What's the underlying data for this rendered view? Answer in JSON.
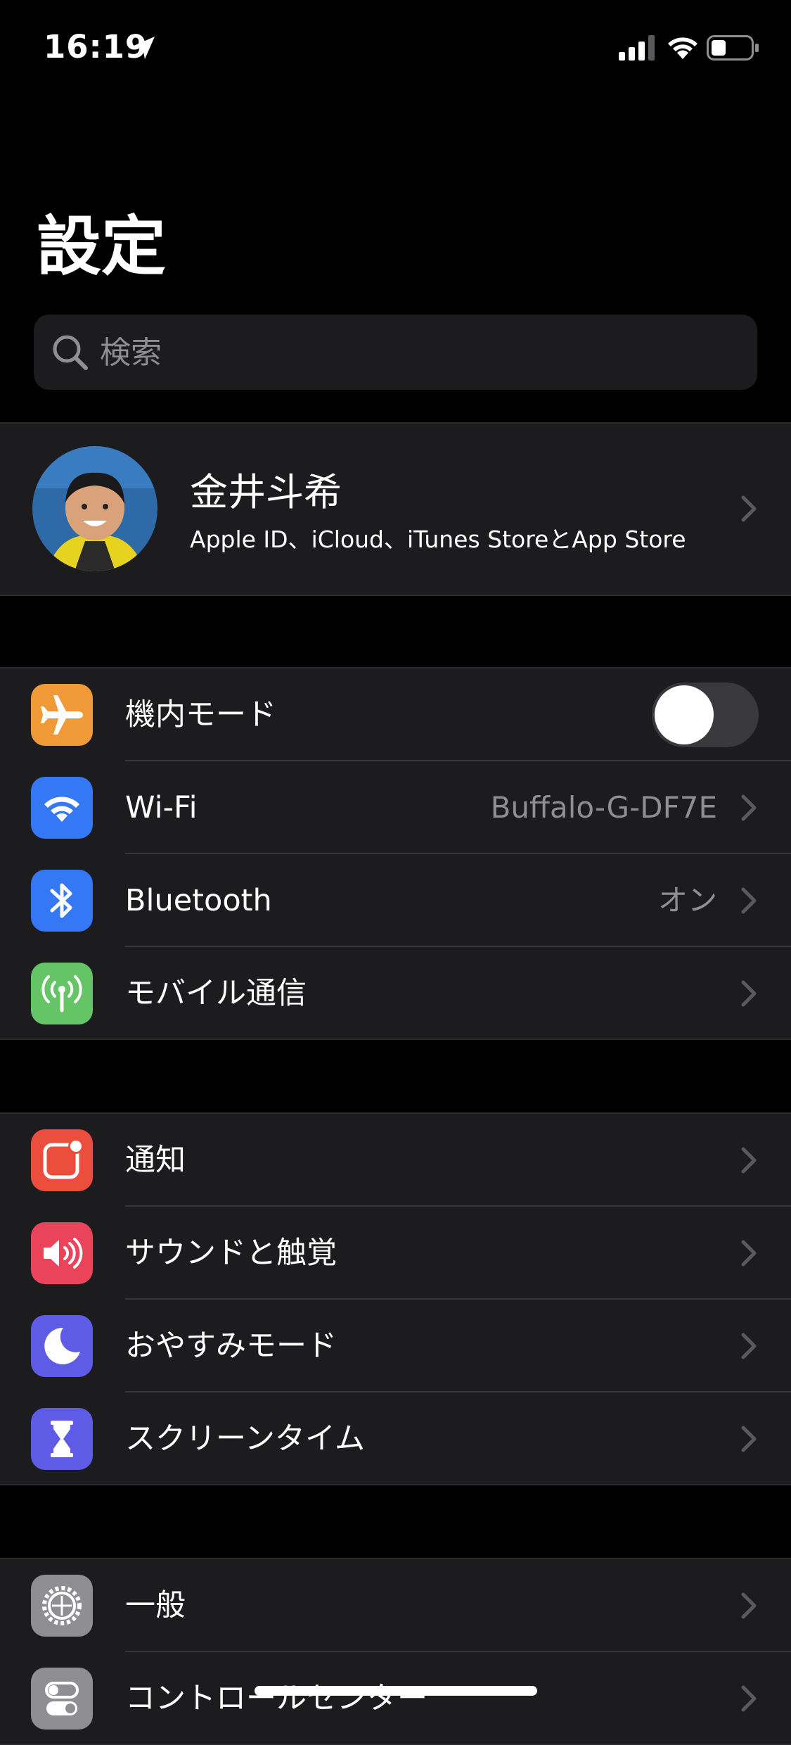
{
  "status_bar": {
    "time": "16:19",
    "icons": [
      "location-arrow-icon",
      "cellular-signal-icon",
      "wifi-icon",
      "battery-icon"
    ]
  },
  "header": {
    "title": "設定"
  },
  "search": {
    "placeholder": "検索",
    "value": ""
  },
  "profile": {
    "name": "金井斗希",
    "subtitle": "Apple ID、iCloud、iTunes StoreとApp Store"
  },
  "section1": {
    "rows": [
      {
        "label": "機内モード",
        "icon": "airplane-icon",
        "color": "#f09a37",
        "control": "toggle",
        "toggle_on": false
      },
      {
        "label": "Wi-Fi",
        "icon": "wifi-icon",
        "color": "#3478f6",
        "value": "Buffalo-G-DF7E"
      },
      {
        "label": "Bluetooth",
        "icon": "bluetooth-icon",
        "color": "#3478f6",
        "value": "オン"
      },
      {
        "label": "モバイル通信",
        "icon": "antenna-icon",
        "color": "#65c466"
      }
    ]
  },
  "section2": {
    "rows": [
      {
        "label": "通知",
        "icon": "notifications-icon",
        "color": "#eb4e3d"
      },
      {
        "label": "サウンドと触覚",
        "icon": "speaker-icon",
        "color": "#eb445a"
      },
      {
        "label": "おやすみモード",
        "icon": "moon-icon",
        "color": "#5e5ce6"
      },
      {
        "label": "スクリーンタイム",
        "icon": "hourglass-icon",
        "color": "#5e5ce6"
      }
    ]
  },
  "section3": {
    "rows": [
      {
        "label": "一般",
        "icon": "gear-icon",
        "color": "#8e8e93"
      },
      {
        "label": "コントロールセンター",
        "icon": "control-center-icon",
        "color": "#8e8e93"
      }
    ]
  }
}
